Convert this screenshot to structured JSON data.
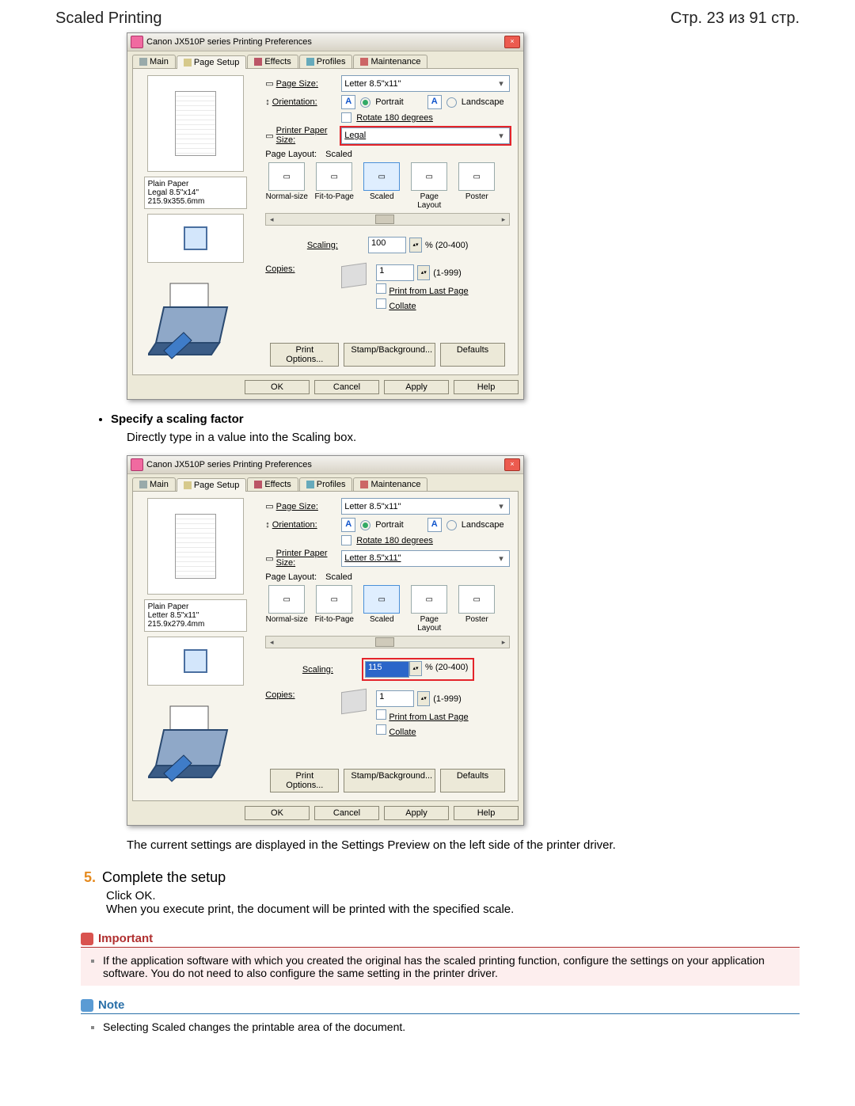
{
  "page": {
    "title": "Scaled Printing",
    "page_indicator": "Стр. 23 из 91 стр."
  },
  "dialog": {
    "title": "Canon JX510P series Printing Preferences",
    "close": "×",
    "tabs": {
      "main": "Main",
      "page_setup": "Page Setup",
      "effects": "Effects",
      "profiles": "Profiles",
      "maintenance": "Maintenance"
    },
    "labels": {
      "page_size": "Page Size:",
      "orientation": "Orientation:",
      "portrait": "Portrait",
      "landscape": "Landscape",
      "rotate": "Rotate 180 degrees",
      "printer_paper_size": "Printer Paper Size:",
      "page_layout": "Page Layout:",
      "scaling": "Scaling:",
      "scaling_hint": "% (20-400)",
      "copies": "Copies:",
      "copies_hint": "(1-999)",
      "print_last": "Print from Last Page",
      "collate": "Collate"
    },
    "layouts": {
      "normal": "Normal-size",
      "fit": "Fit-to-Page",
      "scaled": "Scaled",
      "pagelayout": "Page Layout",
      "poster": "Poster"
    },
    "buttons": {
      "print_options": "Print Options...",
      "stamp": "Stamp/Background...",
      "defaults": "Defaults",
      "ok": "OK",
      "cancel": "Cancel",
      "apply": "Apply",
      "help": "Help"
    },
    "scenario_a": {
      "page_size_value": "Letter 8.5\"x11\"",
      "printer_paper_value": "Legal",
      "layout_value": "Scaled",
      "scaling_value": "100",
      "copies_value": "1",
      "preview_paper": "Plain Paper",
      "preview_dims": "Legal 8.5\"x14\" 215.9x355.6mm"
    },
    "scenario_b": {
      "page_size_value": "Letter 8.5\"x11\"",
      "printer_paper_value": "Letter 8.5\"x11\"",
      "layout_value": "Scaled",
      "scaling_value": "115",
      "copies_value": "1",
      "preview_paper": "Plain Paper",
      "preview_dims": "Letter 8.5\"x11\" 215.9x279.4mm"
    }
  },
  "doc": {
    "bullet_title": "Specify a scaling factor",
    "bullet_text": "Directly type in a value into the Scaling box.",
    "after_dialog_b": "The current settings are displayed in the Settings Preview on the left side of the printer driver.",
    "step5_num": "5.",
    "step5_title": "Complete the setup",
    "step5_line1": "Click OK.",
    "step5_line2": "When you execute print, the document will be printed with the specified scale.",
    "important_title": "Important",
    "important_text": "If the application software with which you created the original has the scaled printing function, configure the settings on your application software. You do not need to also configure the same setting in the printer driver.",
    "note_title": "Note",
    "note_text": "Selecting Scaled changes the printable area of the document."
  }
}
